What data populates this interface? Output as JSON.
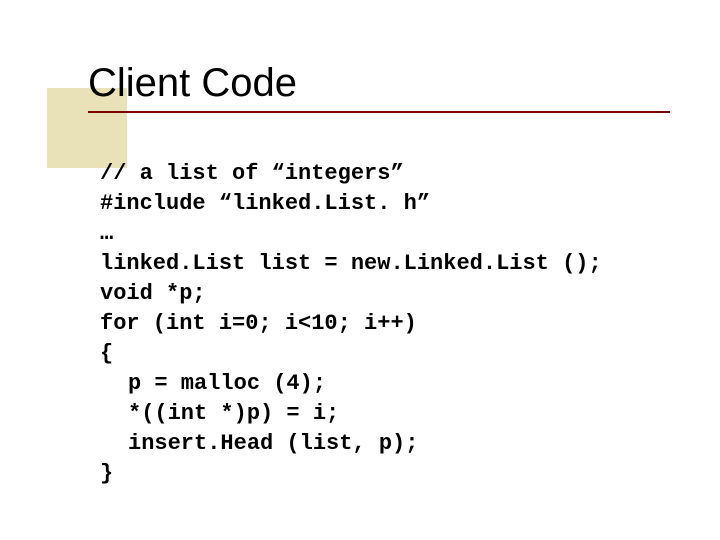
{
  "title": "Client Code",
  "code": {
    "l0": "// a list of “integers”",
    "l1": "#include “linked.List. h”",
    "l2": "…",
    "l3": "linked.List list = new.Linked.List ();",
    "l4": "void *p;",
    "l5": "for (int i=0; i<10; i++)",
    "l6": "{",
    "l7": "p = malloc (4);",
    "l8": "*((int *)p) = i;",
    "l9": "insert.Head (list, p);",
    "l10": "}"
  }
}
